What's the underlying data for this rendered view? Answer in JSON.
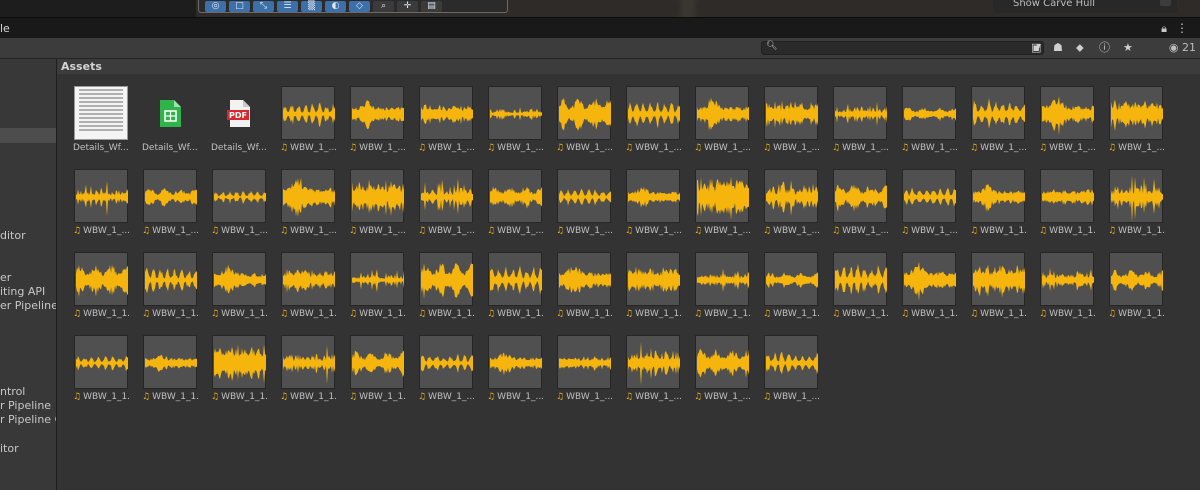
{
  "scene": {
    "tools": [
      "compass-icon",
      "rect-icon",
      "scale-icon",
      "sliders-icon",
      "grid-icon",
      "circle-icon",
      "layers-icon",
      "search-icon",
      "move-icon",
      "camera-icon"
    ],
    "carve_label": "Show Carve Hull"
  },
  "window": {
    "title": "le"
  },
  "searchbar": {
    "placeholder": "",
    "visible_count": "21"
  },
  "left_panel": {
    "items": [
      "ditor",
      "er",
      "iting API",
      "er Pipeline C",
      "ntrol",
      "r Pipeline",
      "r Pipeline Co",
      "itor"
    ]
  },
  "assets": {
    "header": "Assets",
    "items": [
      {
        "label": "Details_Wf...",
        "kind": "sheet-preview"
      },
      {
        "label": "Details_Wf...",
        "kind": "spreadsheet"
      },
      {
        "label": "Details_Wf...",
        "kind": "pdf"
      },
      {
        "label": "WBW_1_...",
        "kind": "audio",
        "wave": 0
      },
      {
        "label": "WBW_1_...",
        "kind": "audio",
        "wave": 1
      },
      {
        "label": "WBW_1_...",
        "kind": "audio",
        "wave": 2
      },
      {
        "label": "WBW_1_...",
        "kind": "audio",
        "wave": 3
      },
      {
        "label": "WBW_1_...",
        "kind": "audio",
        "wave": 4
      },
      {
        "label": "WBW_1_...",
        "kind": "audio",
        "wave": 5
      },
      {
        "label": "WBW_1_...",
        "kind": "audio",
        "wave": 6
      },
      {
        "label": "WBW_1_...",
        "kind": "audio",
        "wave": 7
      },
      {
        "label": "WBW_1_...",
        "kind": "audio",
        "wave": 8
      },
      {
        "label": "WBW_1_...",
        "kind": "audio",
        "wave": 9
      },
      {
        "label": "WBW_1_...",
        "kind": "audio",
        "wave": 10
      },
      {
        "label": "WBW_1_...",
        "kind": "audio",
        "wave": 11
      },
      {
        "label": "WBW_1_...",
        "kind": "audio",
        "wave": 12
      },
      {
        "label": "WBW_1_...",
        "kind": "audio",
        "wave": 13
      },
      {
        "label": "WBW_1_...",
        "kind": "audio",
        "wave": 14
      },
      {
        "label": "WBW_1_...",
        "kind": "audio",
        "wave": 15
      },
      {
        "label": "WBW_1_...",
        "kind": "audio",
        "wave": 16
      },
      {
        "label": "WBW_1_...",
        "kind": "audio",
        "wave": 17
      },
      {
        "label": "WBW_1_...",
        "kind": "audio",
        "wave": 18
      },
      {
        "label": "WBW_1_...",
        "kind": "audio",
        "wave": 19
      },
      {
        "label": "WBW_1_...",
        "kind": "audio",
        "wave": 20
      },
      {
        "label": "WBW_1_...",
        "kind": "audio",
        "wave": 21
      },
      {
        "label": "WBW_1_...",
        "kind": "audio",
        "wave": 22
      },
      {
        "label": "WBW_1_...",
        "kind": "audio",
        "wave": 23
      },
      {
        "label": "WBW_1_...",
        "kind": "audio",
        "wave": 24
      },
      {
        "label": "WBW_1_...",
        "kind": "audio",
        "wave": 25
      },
      {
        "label": "WBW_1_1...",
        "kind": "audio",
        "wave": 26
      },
      {
        "label": "WBW_1_1...",
        "kind": "audio",
        "wave": 27
      },
      {
        "label": "WBW_1_1...",
        "kind": "audio",
        "wave": 28
      },
      {
        "label": "WBW_1_1...",
        "kind": "audio",
        "wave": 29
      },
      {
        "label": "WBW_1_1...",
        "kind": "audio",
        "wave": 30
      },
      {
        "label": "WBW_1_1...",
        "kind": "audio",
        "wave": 31
      },
      {
        "label": "WBW_1_1...",
        "kind": "audio",
        "wave": 32
      },
      {
        "label": "WBW_1_1...",
        "kind": "audio",
        "wave": 33
      },
      {
        "label": "WBW_1_1...",
        "kind": "audio",
        "wave": 34
      },
      {
        "label": "WBW_1_1...",
        "kind": "audio",
        "wave": 35
      },
      {
        "label": "WBW_1_1...",
        "kind": "audio",
        "wave": 36
      },
      {
        "label": "WBW_1_1...",
        "kind": "audio",
        "wave": 37
      },
      {
        "label": "WBW_1_1...",
        "kind": "audio",
        "wave": 38
      },
      {
        "label": "WBW_1_1...",
        "kind": "audio",
        "wave": 39
      },
      {
        "label": "WBW_1_1...",
        "kind": "audio",
        "wave": 40
      },
      {
        "label": "WBW_1_1...",
        "kind": "audio",
        "wave": 41
      },
      {
        "label": "WBW_1_1...",
        "kind": "audio",
        "wave": 42
      },
      {
        "label": "WBW_1_1...",
        "kind": "audio",
        "wave": 43
      },
      {
        "label": "WBW_1_1...",
        "kind": "audio",
        "wave": 44
      },
      {
        "label": "WBW_1_1...",
        "kind": "audio",
        "wave": 45
      },
      {
        "label": "WBW_1_1...",
        "kind": "audio",
        "wave": 46
      },
      {
        "label": "WBW_1_1...",
        "kind": "audio",
        "wave": 47
      },
      {
        "label": "WBW_1_1...",
        "kind": "audio",
        "wave": 48
      },
      {
        "label": "WBW_1_1...",
        "kind": "audio",
        "wave": 49
      },
      {
        "label": "WBW_1_...",
        "kind": "audio",
        "wave": 50
      },
      {
        "label": "WBW_1_...",
        "kind": "audio",
        "wave": 51
      },
      {
        "label": "WBW_1_...",
        "kind": "audio",
        "wave": 52
      },
      {
        "label": "WBW_1_...",
        "kind": "audio",
        "wave": 53
      },
      {
        "label": "WBW_1_...",
        "kind": "audio",
        "wave": 54
      },
      {
        "label": "WBW_1_...",
        "kind": "audio",
        "wave": 55
      }
    ]
  },
  "colors": {
    "waveform": "#f5b50d",
    "selection": "#4d4d4d",
    "tool_active": "#3d6fa8"
  }
}
